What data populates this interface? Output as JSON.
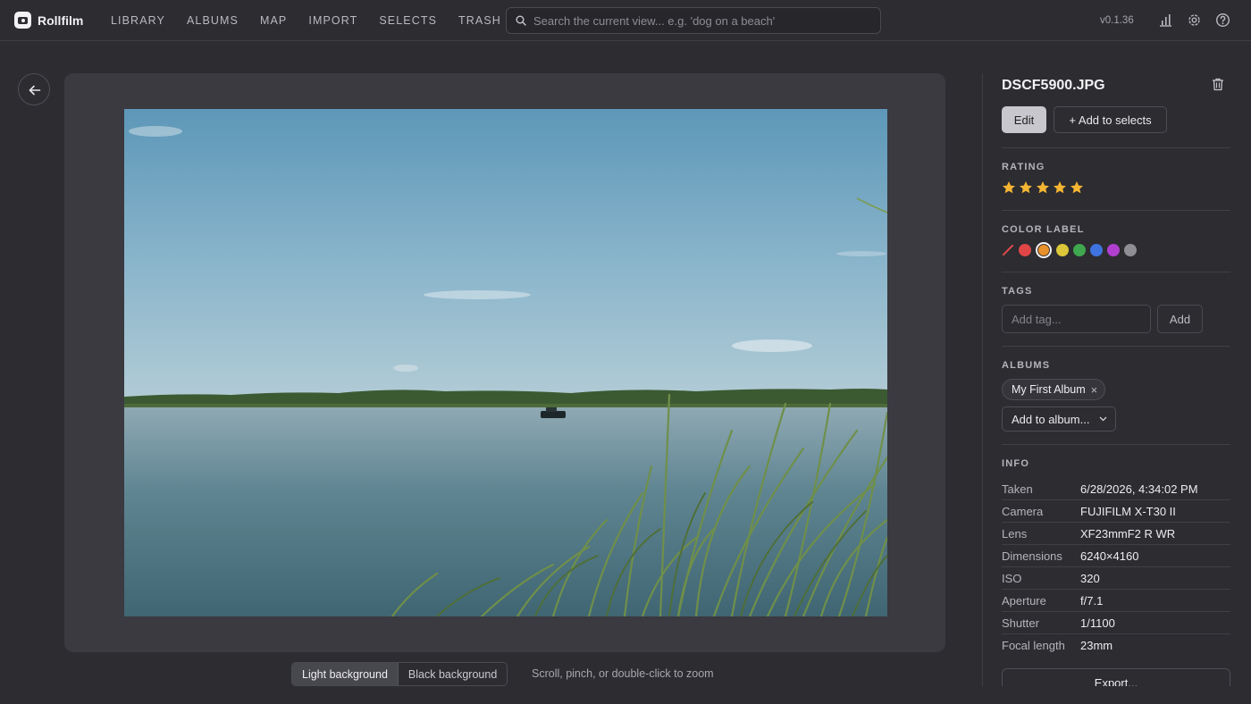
{
  "app": {
    "name": "Rollfilm",
    "version": "v0.1.36"
  },
  "nav": [
    {
      "label": "LIBRARY"
    },
    {
      "label": "ALBUMS"
    },
    {
      "label": "MAP"
    },
    {
      "label": "IMPORT"
    },
    {
      "label": "SELECTS"
    },
    {
      "label": "TRASH"
    }
  ],
  "search": {
    "placeholder": "Search the current view... e.g. 'dog on a beach'",
    "value": ""
  },
  "header_icons": [
    "stats-icon",
    "settings-gear-icon",
    "help-icon"
  ],
  "viewer": {
    "background_options": [
      {
        "label": "Light background",
        "active": true
      },
      {
        "label": "Black background",
        "active": false
      }
    ],
    "zoom_hint": "Scroll, pinch, or double-click to zoom"
  },
  "details": {
    "filename": "DSCF5900.JPG",
    "edit_label": "Edit",
    "add_to_selects_label": "+ Add to selects",
    "rating": {
      "label": "RATING",
      "value": 5,
      "max": 5,
      "color": "#f5b533"
    },
    "color_label": {
      "label": "COLOR LABEL",
      "selected": "orange",
      "options": [
        {
          "name": "none",
          "hex": "none"
        },
        {
          "name": "red",
          "hex": "#e04646"
        },
        {
          "name": "orange",
          "hex": "#e8902a"
        },
        {
          "name": "yellow",
          "hex": "#dcc73a"
        },
        {
          "name": "green",
          "hex": "#3fa84f"
        },
        {
          "name": "blue",
          "hex": "#3f73e0"
        },
        {
          "name": "purple",
          "hex": "#b03fd0"
        },
        {
          "name": "gray",
          "hex": "#8e8e94"
        }
      ]
    },
    "tags": {
      "label": "TAGS",
      "placeholder": "Add tag...",
      "add_label": "Add"
    },
    "albums": {
      "label": "ALBUMS",
      "items": [
        "My First Album"
      ],
      "add_label": "Add to album..."
    },
    "info": {
      "label": "INFO",
      "rows": [
        {
          "key": "Taken",
          "value": "6/28/2026, 4:34:02 PM"
        },
        {
          "key": "Camera",
          "value": "FUJIFILM X-T30 II"
        },
        {
          "key": "Lens",
          "value": "XF23mmF2 R WR"
        },
        {
          "key": "Dimensions",
          "value": "6240×4160"
        },
        {
          "key": "ISO",
          "value": "320"
        },
        {
          "key": "Aperture",
          "value": "f/7.1"
        },
        {
          "key": "Shutter",
          "value": "1/1100"
        },
        {
          "key": "Focal length",
          "value": "23mm"
        }
      ]
    },
    "export_label": "Export..."
  }
}
